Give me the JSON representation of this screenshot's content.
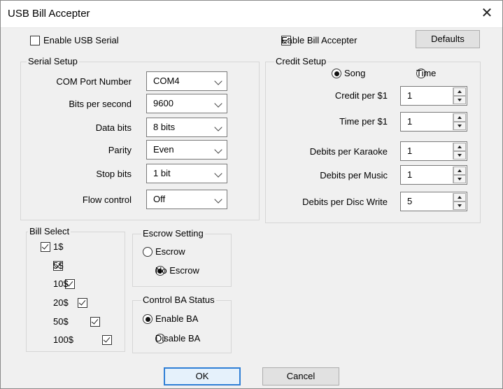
{
  "window": {
    "title": "USB Bill Accepter"
  },
  "top": {
    "enable_usb_serial": {
      "label": "Enable USB Serial",
      "checked": false
    },
    "enable_bill_accepter": {
      "label": "Eable Bill Accepter",
      "checked": true
    },
    "defaults_label": "Defaults"
  },
  "serial_setup": {
    "title": "Serial Setup",
    "fields": [
      {
        "label": "COM Port Number",
        "value": "COM4"
      },
      {
        "label": "Bits per second",
        "value": "9600"
      },
      {
        "label": "Data bits",
        "value": "8 bits"
      },
      {
        "label": "Parity",
        "value": "Even"
      },
      {
        "label": "Stop bits",
        "value": "1 bit"
      },
      {
        "label": "Flow control",
        "value": "Off"
      }
    ]
  },
  "credit_setup": {
    "title": "Credit Setup",
    "mode_song": "Song",
    "mode_time": "Time",
    "selected_mode": "Song",
    "fields": [
      {
        "label": "Credit per $1",
        "value": "1"
      },
      {
        "label": "Time per $1",
        "value": "1"
      },
      {
        "label": "Debits per Karaoke",
        "value": "1"
      },
      {
        "label": "Debits per Music",
        "value": "1"
      },
      {
        "label": "Debits per Disc Write",
        "value": "5"
      }
    ]
  },
  "bill_select": {
    "title": "Bill Select",
    "items": [
      {
        "label": "1$",
        "checked": true
      },
      {
        "label": "5$",
        "checked": true
      },
      {
        "label": "10$",
        "checked": true
      },
      {
        "label": "20$",
        "checked": true
      },
      {
        "label": "50$",
        "checked": true
      },
      {
        "label": "100$",
        "checked": true
      }
    ]
  },
  "escrow": {
    "title": "Escrow Setting",
    "options": [
      "Escrow",
      "No Escrow"
    ],
    "selected": "No Escrow"
  },
  "ba_status": {
    "title": "Control BA Status",
    "options": [
      "Enable BA",
      "Disable BA"
    ],
    "selected": "Enable BA"
  },
  "footer": {
    "ok_label": "OK",
    "cancel_label": "Cancel"
  },
  "colors": {
    "default_button_border": "#2f7fd6",
    "window_bg": "#f0f0f0"
  }
}
